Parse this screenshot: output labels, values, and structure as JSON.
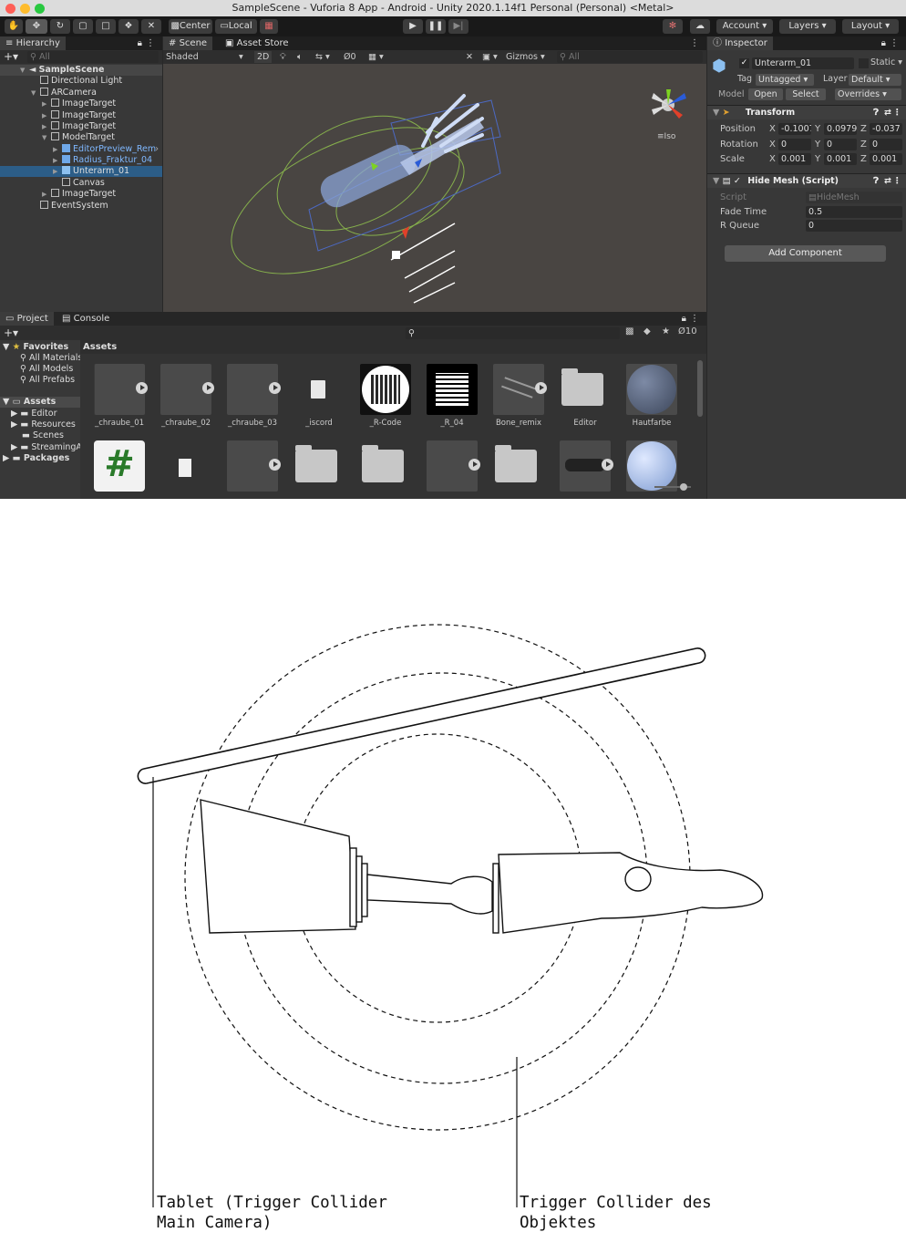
{
  "window": {
    "title": "SampleScene - Vuforia 8 App - Android - Unity 2020.1.14f1 Personal (Personal) <Metal>"
  },
  "toolbar": {
    "pivot_label": "Center",
    "space_label": "Local",
    "account_label": "Account",
    "layers_label": "Layers",
    "layout_label": "Layout"
  },
  "hierarchy": {
    "tab_label": "Hierarchy",
    "search_placeholder": "All",
    "items": [
      {
        "label": "SampleScene"
      },
      {
        "label": "Directional Light"
      },
      {
        "label": "ARCamera"
      },
      {
        "label": "ImageTarget"
      },
      {
        "label": "ImageTarget"
      },
      {
        "label": "ImageTarget"
      },
      {
        "label": "ModelTarget"
      },
      {
        "label": "EditorPreview_Rem"
      },
      {
        "label": "Radius_Fraktur_04"
      },
      {
        "label": "Unterarm_01"
      },
      {
        "label": "Canvas"
      },
      {
        "label": "ImageTarget"
      },
      {
        "label": "EventSystem"
      }
    ]
  },
  "scene": {
    "tabs": [
      {
        "label": "Scene"
      },
      {
        "label": "Asset Store"
      }
    ],
    "shading_mode": "Shaded",
    "toggle_2d": "2D",
    "hidden_count": "0",
    "gizmos_label": "Gizmos",
    "search_placeholder": "All",
    "projection_label": "Iso"
  },
  "inspector": {
    "tab_label": "Inspector",
    "object_name": "Unterarm_01",
    "static_label": "Static",
    "tag_label": "Tag",
    "tag_value": "Untagged",
    "layer_label": "Layer",
    "layer_value": "Default",
    "model_label": "Model",
    "open_label": "Open",
    "select_label": "Select",
    "overrides_label": "Overrides",
    "transform": {
      "title": "Transform",
      "position_label": "Position",
      "rotation_label": "Rotation",
      "scale_label": "Scale",
      "position": {
        "x": "-0.1007",
        "y": "0.0979",
        "z": "-0.037"
      },
      "rotation": {
        "x": "0",
        "y": "0",
        "z": "0"
      },
      "scale": {
        "x": "0.001",
        "y": "0.001",
        "z": "0.001"
      }
    },
    "hide_mesh": {
      "title": "Hide Mesh (Script)",
      "script_label": "Script",
      "script_value": "HideMesh",
      "fade_time_label": "Fade Time",
      "fade_time_value": "0.5",
      "r_queue_label": "R Queue",
      "r_queue_value": "0"
    },
    "add_component_label": "Add Component"
  },
  "project": {
    "tabs": [
      {
        "label": "Project"
      },
      {
        "label": "Console"
      }
    ],
    "hidden_count": "10",
    "tree": [
      {
        "label": "Favorites"
      },
      {
        "label": "All Materials"
      },
      {
        "label": "All Models"
      },
      {
        "label": "All Prefabs"
      },
      {
        "label": "Assets"
      },
      {
        "label": "Editor"
      },
      {
        "label": "Resources"
      },
      {
        "label": "Scenes"
      },
      {
        "label": "StreamingA"
      },
      {
        "label": "Packages"
      }
    ],
    "assets_header": "Assets",
    "assets": [
      {
        "label": "_chraube_01"
      },
      {
        "label": "_chraube_02"
      },
      {
        "label": "_chraube_03"
      },
      {
        "label": "_iscord"
      },
      {
        "label": "_R-Code"
      },
      {
        "label": "_R_04"
      },
      {
        "label": "Bone_remix"
      },
      {
        "label": "Editor"
      },
      {
        "label": "Hautfarbe"
      }
    ]
  },
  "diagram": {
    "label_tablet": "Tablet (Trigger Collider\nMain Camera)",
    "label_object": "Trigger Collider des\nObjektes"
  },
  "colors": {
    "selection": "#2c5d87",
    "prefab_blue": "#7fb8ff",
    "panel_bg": "#383838",
    "scene_bg": "#494542"
  }
}
